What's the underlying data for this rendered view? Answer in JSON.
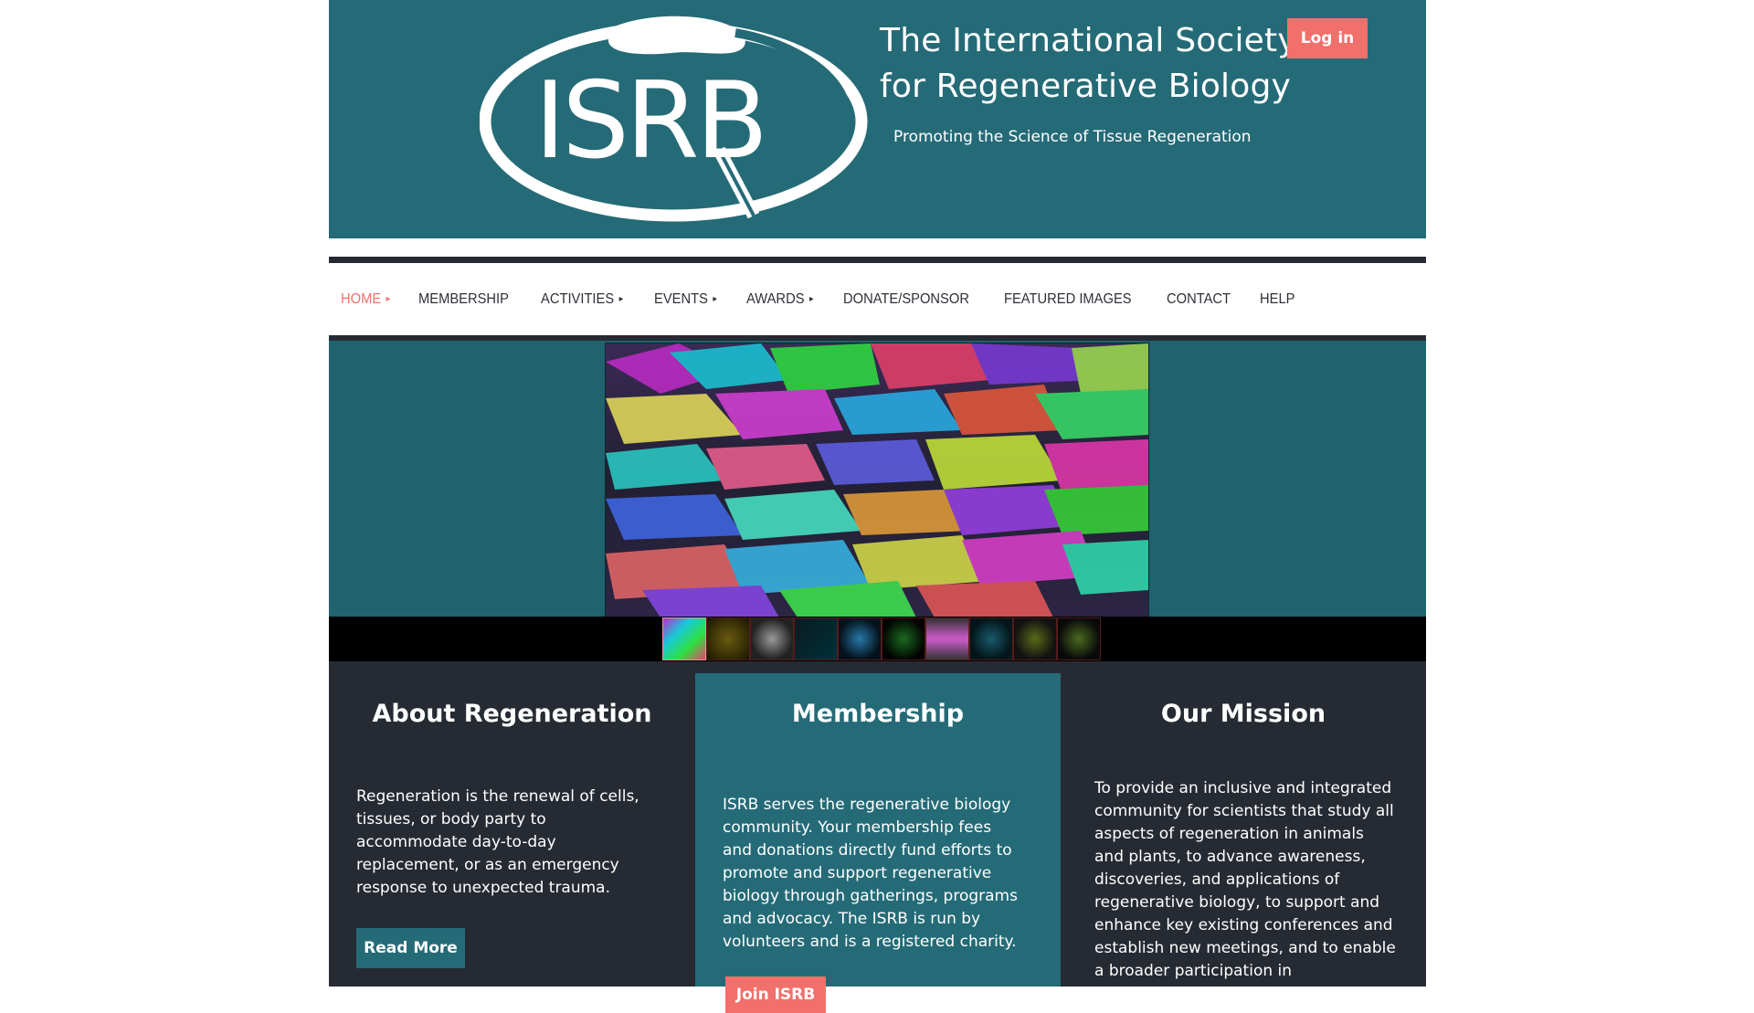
{
  "header": {
    "logo_text": "ISRB",
    "title_line1": "The International Society",
    "title_line2": "for Regenerative Biology",
    "tagline": "Promoting the Science of Tissue Regeneration",
    "login_label": "Log in"
  },
  "nav": {
    "items": [
      {
        "label": "HOME",
        "caret": "▸"
      },
      {
        "label": "MEMBERSHIP"
      },
      {
        "label": "ACTIVITIES",
        "caret": "▸"
      },
      {
        "label": "EVENTS",
        "caret": "▸"
      },
      {
        "label": "AWARDS",
        "caret": "▸"
      },
      {
        "label": "DONATE/SPONSOR"
      },
      {
        "label": "FEATURED IMAGES"
      },
      {
        "label": "CONTACT"
      },
      {
        "label": "HELP"
      }
    ]
  },
  "slideshow": {
    "thumbnail_count": 10,
    "active_index": 0
  },
  "columns": {
    "about": {
      "title": "About Regeneration",
      "text": "Regeneration is the renewal of cells, tissues, or body party to accommodate day-to-day replacement, or as an emergency response to unexpected trauma.",
      "button": "Read More"
    },
    "membership": {
      "title": "Membership",
      "text": "ISRB serves the regenerative biology community. Your membership fees and donations directly fund efforts to promote and support regenerative biology through gatherings, programs and advocacy. The ISRB is run by volunteers and is a registered charity.",
      "button": "Join ISRB"
    },
    "mission": {
      "title": "Our Mission",
      "text": "To provide an inclusive and integrated community for scientists that study all aspects of regeneration in animals and plants, to advance awareness, discoveries, and applications of regenerative biology, to support and enhance key existing conferences and establish new meetings, and to enable a broader participation in regenerative"
    }
  },
  "colors": {
    "teal": "#256b77",
    "dark": "#262b33",
    "accent": "#f2706b"
  }
}
